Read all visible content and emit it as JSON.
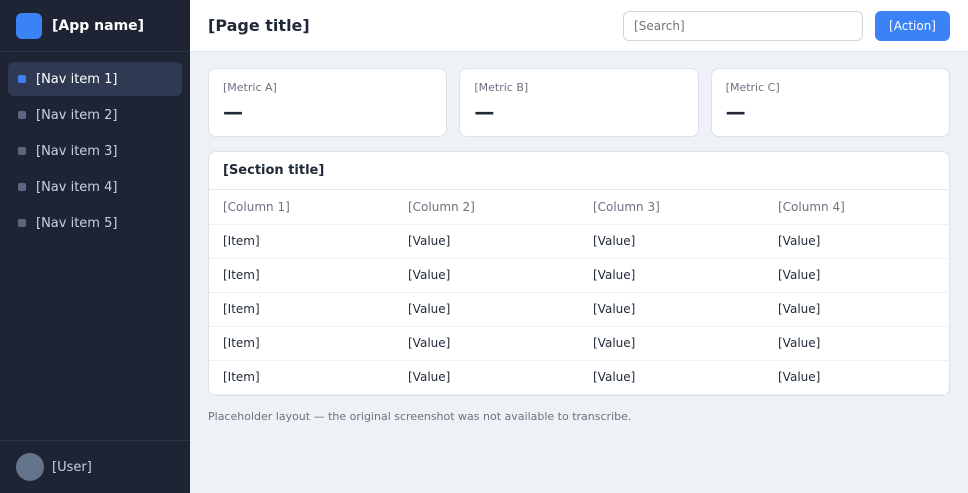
{
  "app": {
    "name": "[App name]"
  },
  "nav": [
    {
      "label": "[Nav item 1]"
    },
    {
      "label": "[Nav item 2]"
    },
    {
      "label": "[Nav item 3]"
    },
    {
      "label": "[Nav item 4]"
    },
    {
      "label": "[Nav item 5]"
    }
  ],
  "user": {
    "name": "[User]"
  },
  "header": {
    "title": "[Page title]",
    "search_placeholder": "[Search]",
    "action_label": "[Action]"
  },
  "stats": [
    {
      "label": "[Metric A]",
      "value": "—"
    },
    {
      "label": "[Metric B]",
      "value": "—"
    },
    {
      "label": "[Metric C]",
      "value": "—"
    }
  ],
  "table": {
    "title": "[Section title]",
    "columns": [
      "[Column 1]",
      "[Column 2]",
      "[Column 3]",
      "[Column 4]"
    ],
    "rows": [
      [
        "[Item]",
        "[Value]",
        "[Value]",
        "[Value]"
      ],
      [
        "[Item]",
        "[Value]",
        "[Value]",
        "[Value]"
      ],
      [
        "[Item]",
        "[Value]",
        "[Value]",
        "[Value]"
      ],
      [
        "[Item]",
        "[Value]",
        "[Value]",
        "[Value]"
      ],
      [
        "[Item]",
        "[Value]",
        "[Value]",
        "[Value]"
      ]
    ]
  },
  "footer": {
    "note": "Placeholder layout — the original screenshot was not available to transcribe."
  }
}
